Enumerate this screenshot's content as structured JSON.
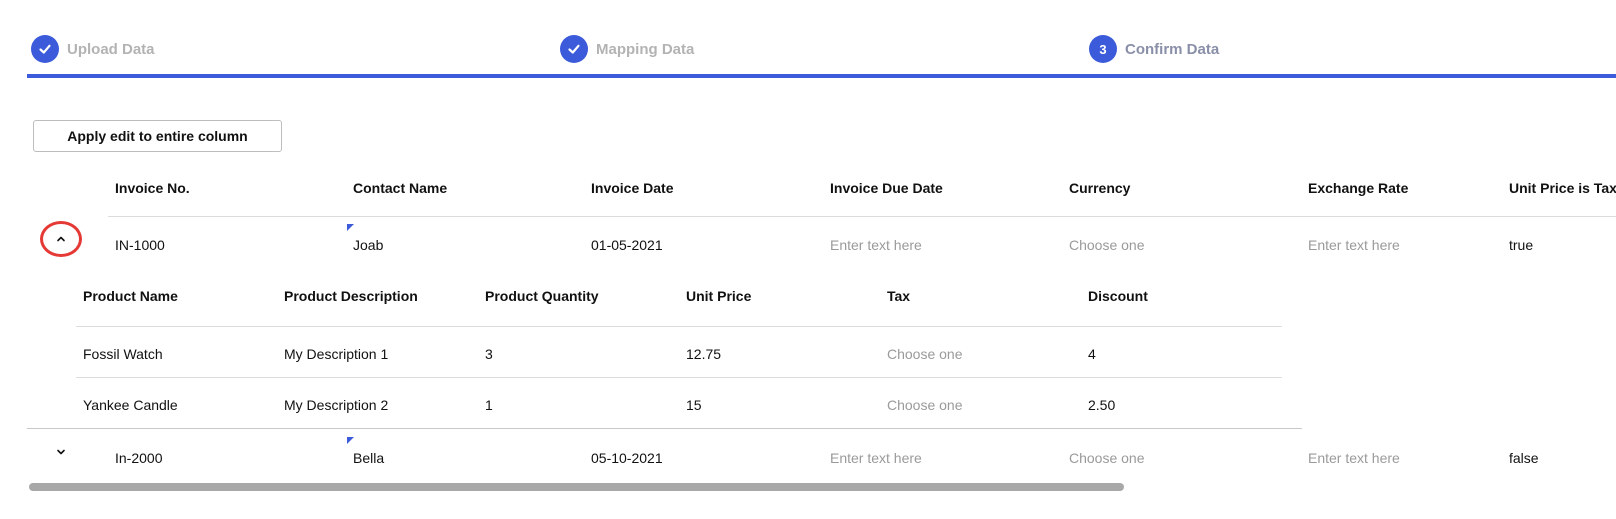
{
  "stepper": {
    "steps": [
      {
        "label": "Upload Data",
        "state": "done",
        "icon": "check-icon"
      },
      {
        "label": "Mapping Data",
        "state": "done",
        "icon": "check-icon"
      },
      {
        "label": "Confirm Data",
        "state": "active",
        "number": "3"
      }
    ],
    "accent_color": "#3b5bdb"
  },
  "toolbar": {
    "apply_label": "Apply edit to entire column"
  },
  "table": {
    "columns": [
      "Invoice No.",
      "Contact Name",
      "Invoice Date",
      "Invoice Due Date",
      "Currency",
      "Exchange Rate",
      "Unit Price is Tax I"
    ],
    "rows": [
      {
        "expanded": true,
        "toggle_icon": "chevron-up-icon",
        "invoice_no": "IN-1000",
        "contact_name": "Joab",
        "invoice_date": "01-05-2021",
        "invoice_due_date_placeholder": "Enter text here",
        "currency_placeholder": "Choose one",
        "exchange_rate_placeholder": "Enter text here",
        "unit_price_tax_inclusive": "true"
      },
      {
        "expanded": false,
        "toggle_icon": "chevron-down-icon",
        "invoice_no": "In-2000",
        "contact_name": "Bella",
        "invoice_date": "05-10-2021",
        "invoice_due_date_placeholder": "Enter text here",
        "currency_placeholder": "Choose one",
        "exchange_rate_placeholder": "Enter text here",
        "unit_price_tax_inclusive": "false"
      }
    ]
  },
  "subtable": {
    "columns": [
      "Product Name",
      "Product Description",
      "Product Quantity",
      "Unit Price",
      "Tax",
      "Discount"
    ],
    "rows": [
      {
        "product_name": "Fossil Watch",
        "description": "My Description 1",
        "quantity": "3",
        "unit_price": "12.75",
        "tax_placeholder": "Choose one",
        "discount": "4"
      },
      {
        "product_name": "Yankee Candle",
        "description": "My Description 2",
        "quantity": "1",
        "unit_price": "15",
        "tax_placeholder": "Choose one",
        "discount": "2.50"
      }
    ]
  },
  "highlight_color": "#e53935"
}
